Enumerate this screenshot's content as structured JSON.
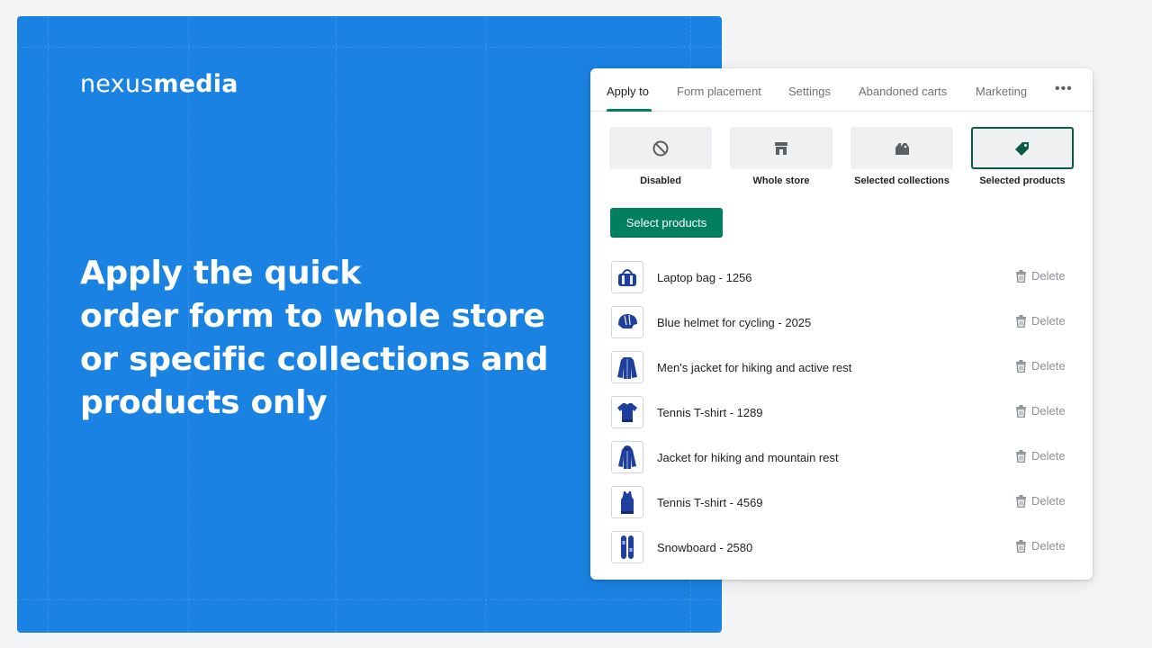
{
  "brand": {
    "light": "nexus",
    "bold": "media"
  },
  "headline": {
    "lines": [
      "Apply the quick",
      "order form to whole store",
      "or specific collections and",
      "products only"
    ]
  },
  "tabs": [
    {
      "label": "Apply to",
      "active": true
    },
    {
      "label": "Form placement",
      "active": false
    },
    {
      "label": "Settings",
      "active": false
    },
    {
      "label": "Abandoned carts",
      "active": false
    },
    {
      "label": "Marketing",
      "active": false
    }
  ],
  "more_icon": "more-horizontal-icon",
  "options": [
    {
      "label": "Disabled",
      "icon": "disabled-icon",
      "selected": false
    },
    {
      "label": "Whole store",
      "icon": "store-icon",
      "selected": false
    },
    {
      "label": "Selected collections",
      "icon": "collections-icon",
      "selected": false
    },
    {
      "label": "Selected products",
      "icon": "tag-icon",
      "selected": true
    }
  ],
  "select_button_label": "Select products",
  "products": [
    {
      "name": "Laptop bag - 1256",
      "thumb": "bag"
    },
    {
      "name": "Blue helmet for cycling - 2025",
      "thumb": "helmet"
    },
    {
      "name": "Men's jacket for hiking and active rest",
      "thumb": "jacket"
    },
    {
      "name": "Tennis T-shirt - 1289",
      "thumb": "tshirt"
    },
    {
      "name": "Jacket for hiking and mountain rest",
      "thumb": "hoodie"
    },
    {
      "name": "Tennis T-shirt - 4569",
      "thumb": "tank"
    },
    {
      "name": "Snowboard - 2580",
      "thumb": "snowboard"
    }
  ],
  "delete_label": "Delete",
  "colors": {
    "hero_bg": "#1a82e2",
    "primary_button": "#008060",
    "selected_border": "#0b5b4a",
    "product_blue": "#1f3f9e"
  }
}
